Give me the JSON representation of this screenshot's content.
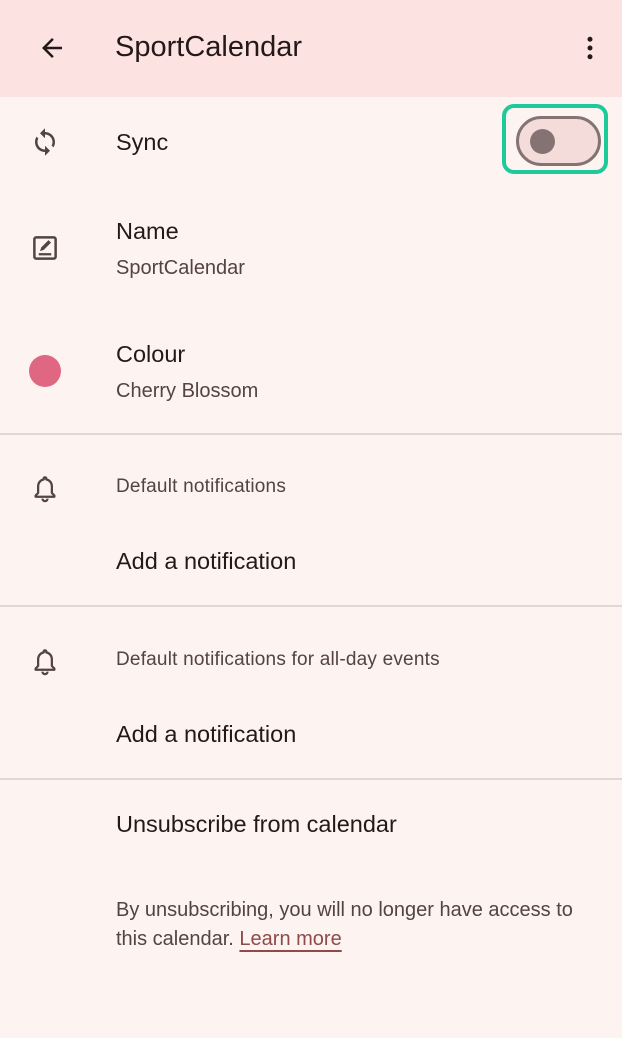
{
  "app_bar": {
    "title": "SportCalendar",
    "back_icon": "arrow-back-icon",
    "menu_icon": "more-vert-icon"
  },
  "sync": {
    "label": "Sync",
    "enabled": false,
    "icon": "sync-icon"
  },
  "name": {
    "label": "Name",
    "value": "SportCalendar",
    "icon": "edit-square-icon"
  },
  "colour": {
    "label": "Colour",
    "value": "Cherry Blossom",
    "swatch": "#e06782"
  },
  "default_notifications": {
    "title": "Default notifications",
    "action": "Add a notification",
    "icon": "bell-icon"
  },
  "allday_notifications": {
    "title": "Default notifications for all-day events",
    "action": "Add a notification",
    "icon": "bell-icon"
  },
  "unsubscribe": {
    "label": "Unsubscribe from calendar",
    "description": "By unsubscribing, you will no longer have access to this calendar.",
    "learn_more": "Learn more"
  },
  "colors": {
    "app_bar_bg": "#fce3e1",
    "page_bg": "#fdf3f1",
    "highlight": "#1ec99a",
    "link": "#8f4a4a"
  }
}
